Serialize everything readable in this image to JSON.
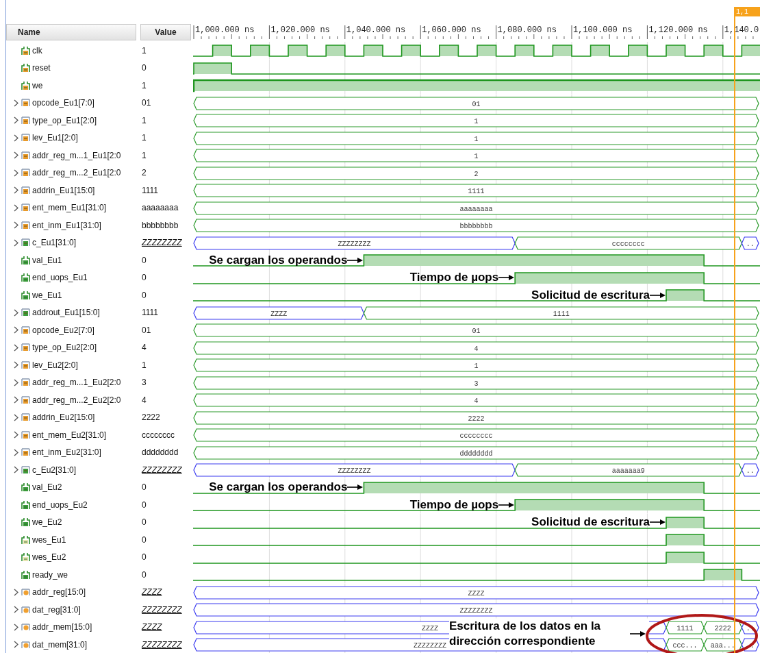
{
  "columns": {
    "name": "Name",
    "value": "Value"
  },
  "cursor": {
    "label": "1,1"
  },
  "ruler": [
    "1,000.000 ns",
    "1,020.000 ns",
    "1,040.000 ns",
    "1,060.000 ns",
    "1,080.000 ns",
    "1,100.000 ns",
    "1,120.000 ns",
    "1,140.0"
  ],
  "signals": [
    {
      "name": "clk",
      "value": "1",
      "kind": "bit",
      "color": "#e89a2a"
    },
    {
      "name": "reset",
      "value": "0",
      "kind": "bit",
      "color": "#e89a2a"
    },
    {
      "name": "we",
      "value": "1",
      "kind": "bit",
      "color": "#e89a2a"
    },
    {
      "name": "opcode_Eu1[7:0]",
      "value": "01",
      "kind": "bus",
      "color": "#e89a2a",
      "expanded": false,
      "highz": false,
      "segments": [
        {
          "text": "01",
          "highz": false
        }
      ]
    },
    {
      "name": "type_op_Eu1[2:0]",
      "value": "1",
      "kind": "bus",
      "color": "#e89a2a",
      "expanded": false,
      "highz": false,
      "segments": [
        {
          "text": "1",
          "highz": false
        }
      ]
    },
    {
      "name": "lev_Eu1[2:0]",
      "value": "1",
      "kind": "bus",
      "color": "#e89a2a",
      "expanded": false,
      "highz": false,
      "segments": [
        {
          "text": "1",
          "highz": false
        }
      ]
    },
    {
      "name": "addr_reg_m...1_Eu1[2:0",
      "value": "1",
      "kind": "bus",
      "color": "#e89a2a",
      "expanded": false,
      "highz": false,
      "segments": [
        {
          "text": "1",
          "highz": false
        }
      ]
    },
    {
      "name": "addr_reg_m...2_Eu1[2:0",
      "value": "2",
      "kind": "bus",
      "color": "#e89a2a",
      "expanded": false,
      "highz": false,
      "segments": [
        {
          "text": "2",
          "highz": false
        }
      ]
    },
    {
      "name": "addrin_Eu1[15:0]",
      "value": "1111",
      "kind": "bus",
      "color": "#e89a2a",
      "expanded": false,
      "highz": false,
      "segments": [
        {
          "text": "1111",
          "highz": false
        }
      ]
    },
    {
      "name": "ent_mem_Eu1[31:0]",
      "value": "aaaaaaaa",
      "kind": "bus",
      "color": "#e89a2a",
      "expanded": false,
      "highz": false,
      "segments": [
        {
          "text": "aaaaaaaa",
          "highz": false
        }
      ]
    },
    {
      "name": "ent_inm_Eu1[31:0]",
      "value": "bbbbbbbb",
      "kind": "bus",
      "color": "#e89a2a",
      "expanded": false,
      "highz": false,
      "segments": [
        {
          "text": "bbbbbbbb",
          "highz": false
        }
      ]
    },
    {
      "name": "c_Eu1[31:0]",
      "value": "ZZZZZZZZ",
      "kind": "bus",
      "color": "#3a9a3a",
      "expanded": false,
      "highz": true,
      "segments": [
        {
          "text": "ZZZZZZZZ",
          "highz": true
        },
        {
          "text": "cccccccc",
          "highz": false
        },
        {
          "text": "..",
          "highz": true
        }
      ]
    },
    {
      "name": "val_Eu1",
      "value": "0",
      "kind": "bit",
      "color": "#3a9a3a",
      "annotation": "Se cargan los operandos"
    },
    {
      "name": "end_uops_Eu1",
      "value": "0",
      "kind": "bit",
      "color": "#3a9a3a",
      "annotation": "Tiempo de µops"
    },
    {
      "name": "we_Eu1",
      "value": "0",
      "kind": "bit",
      "color": "#3a9a3a",
      "annotation": "Solicitud de escritura"
    },
    {
      "name": "addrout_Eu1[15:0]",
      "value": "1111",
      "kind": "bus",
      "color": "#3a9a3a",
      "expanded": false,
      "highz": false,
      "segments": [
        {
          "text": "ZZZZ",
          "highz": true
        },
        {
          "text": "1111",
          "highz": false
        }
      ]
    },
    {
      "name": "opcode_Eu2[7:0]",
      "value": "01",
      "kind": "bus",
      "color": "#e89a2a",
      "expanded": false,
      "highz": false,
      "segments": [
        {
          "text": "01",
          "highz": false
        }
      ]
    },
    {
      "name": "type_op_Eu2[2:0]",
      "value": "4",
      "kind": "bus",
      "color": "#e89a2a",
      "expanded": false,
      "highz": false,
      "segments": [
        {
          "text": "4",
          "highz": false
        }
      ]
    },
    {
      "name": "lev_Eu2[2:0]",
      "value": "1",
      "kind": "bus",
      "color": "#e89a2a",
      "expanded": false,
      "highz": false,
      "segments": [
        {
          "text": "1",
          "highz": false
        }
      ]
    },
    {
      "name": "addr_reg_m...1_Eu2[2:0",
      "value": "3",
      "kind": "bus",
      "color": "#e89a2a",
      "expanded": false,
      "highz": false,
      "segments": [
        {
          "text": "3",
          "highz": false
        }
      ]
    },
    {
      "name": "addr_reg_m...2_Eu2[2:0",
      "value": "4",
      "kind": "bus",
      "color": "#e89a2a",
      "expanded": false,
      "highz": false,
      "segments": [
        {
          "text": "4",
          "highz": false
        }
      ]
    },
    {
      "name": "addrin_Eu2[15:0]",
      "value": "2222",
      "kind": "bus",
      "color": "#e89a2a",
      "expanded": false,
      "highz": false,
      "segments": [
        {
          "text": "2222",
          "highz": false
        }
      ]
    },
    {
      "name": "ent_mem_Eu2[31:0]",
      "value": "cccccccc",
      "kind": "bus",
      "color": "#e89a2a",
      "expanded": false,
      "highz": false,
      "segments": [
        {
          "text": "cccccccc",
          "highz": false
        }
      ]
    },
    {
      "name": "ent_inm_Eu2[31:0]",
      "value": "dddddddd",
      "kind": "bus",
      "color": "#e89a2a",
      "expanded": false,
      "highz": false,
      "segments": [
        {
          "text": "dddddddd",
          "highz": false
        }
      ]
    },
    {
      "name": "c_Eu2[31:0]",
      "value": "ZZZZZZZZ",
      "kind": "bus",
      "color": "#3a9a3a",
      "expanded": false,
      "highz": true,
      "segments": [
        {
          "text": "ZZZZZZZZ",
          "highz": true
        },
        {
          "text": "aaaaaaa9",
          "highz": false
        },
        {
          "text": "..",
          "highz": true
        }
      ]
    },
    {
      "name": "val_Eu2",
      "value": "0",
      "kind": "bit",
      "color": "#3a9a3a",
      "annotation": "Se cargan los operandos"
    },
    {
      "name": "end_uops_Eu2",
      "value": "0",
      "kind": "bit",
      "color": "#3a9a3a",
      "annotation": "Tiempo de µops"
    },
    {
      "name": "we_Eu2",
      "value": "0",
      "kind": "bit",
      "color": "#3a9a3a",
      "annotation": "Solicitud de escritura"
    },
    {
      "name": "wes_Eu1",
      "value": "0",
      "kind": "bit",
      "color": "#e8e4b0"
    },
    {
      "name": "wes_Eu2",
      "value": "0",
      "kind": "bit",
      "color": "#e8e4b0"
    },
    {
      "name": "ready_we",
      "value": "0",
      "kind": "bit",
      "color": "#3a9a3a"
    },
    {
      "name": "addr_reg[15:0]",
      "value": "ZZZZ",
      "kind": "regbus",
      "color": "#f0a030",
      "expanded": false,
      "highz": true,
      "segments": [
        {
          "text": "ZZZZ",
          "highz": true
        }
      ]
    },
    {
      "name": "dat_reg[31:0]",
      "value": "ZZZZZZZZ",
      "kind": "regbus",
      "color": "#f0a030",
      "expanded": false,
      "highz": true,
      "segments": [
        {
          "text": "ZZZZZZZZ",
          "highz": true
        }
      ]
    },
    {
      "name": "addr_mem[15:0]",
      "value": "ZZZZ",
      "kind": "regbus",
      "color": "#f0a030",
      "expanded": false,
      "highz": true,
      "segments": [
        {
          "text": "ZZZZ",
          "highz": true
        },
        {
          "text": "1111",
          "highz": false
        },
        {
          "text": "2222",
          "highz": false
        },
        {
          "text": "..",
          "highz": true
        }
      ]
    },
    {
      "name": "dat_mem[31:0]",
      "value": "ZZZZZZZZ",
      "kind": "regbus",
      "color": "#f0a030",
      "expanded": false,
      "highz": true,
      "segments": [
        {
          "text": "ZZZZZZZZ",
          "highz": true
        },
        {
          "text": "ccc...",
          "highz": false
        },
        {
          "text": "aaa...",
          "highz": false
        },
        {
          "text": "..",
          "highz": true
        }
      ]
    }
  ],
  "callout": {
    "text": "Escritura de los datos en la dirección correspondiente"
  }
}
